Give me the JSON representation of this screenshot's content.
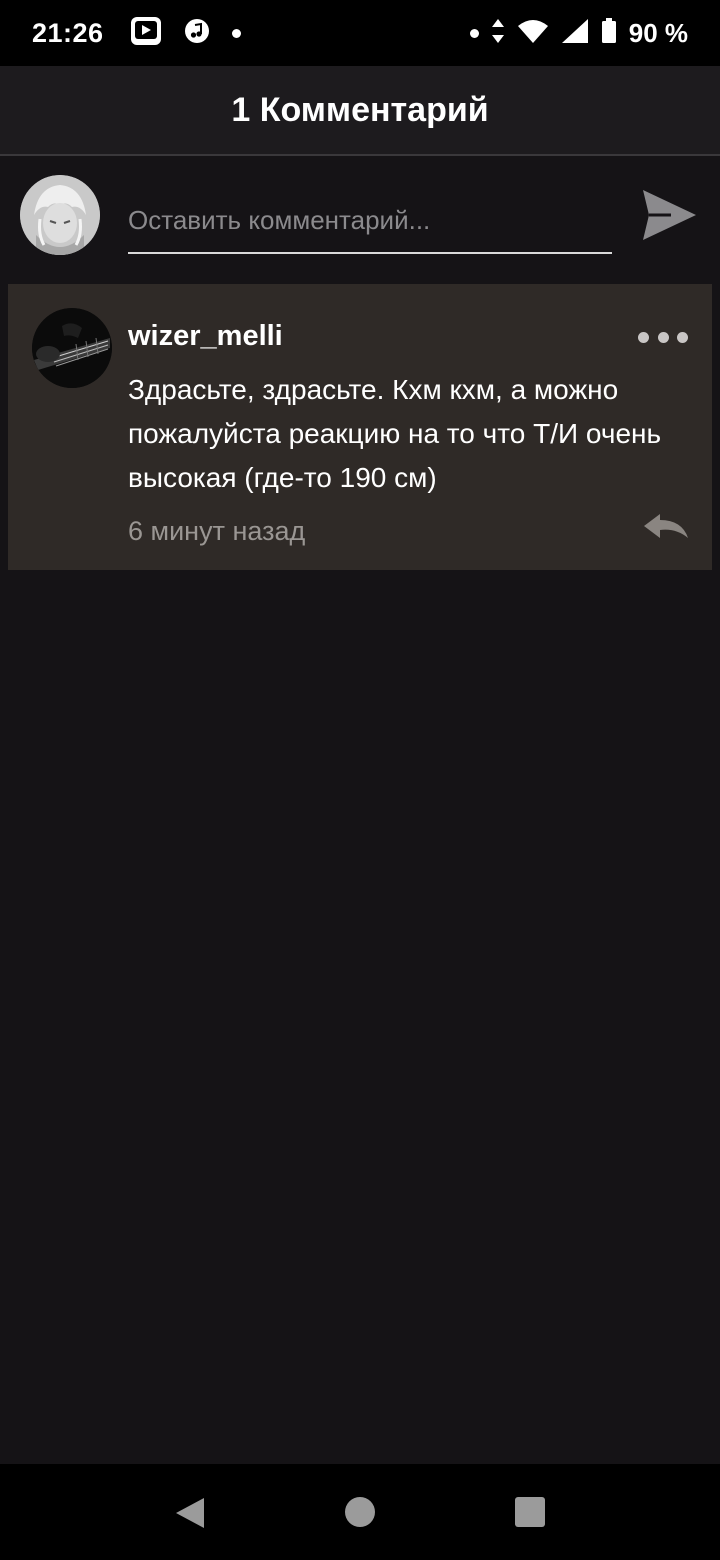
{
  "status_bar": {
    "time": "21:26",
    "battery": "90 %",
    "icons": [
      "video-app-icon",
      "music-icon",
      "notification-dot",
      "data-arrows-icon",
      "wifi-icon",
      "signal-icon",
      "battery-icon"
    ]
  },
  "header": {
    "title": "1 Комментарий"
  },
  "comment_input": {
    "placeholder": "Оставить комментарий..."
  },
  "comments": [
    {
      "author": "wizer_melli",
      "text": "Здрасьте, здрасьте. Кхм кхм, а можно пожалуйста реакцию на то что Т/И очень высокая (где-то 190 см)",
      "time": "6 минут назад"
    }
  ],
  "colors": {
    "background": "#151316",
    "header": "#1d1b1e",
    "card": "#2f2a27",
    "muted_text": "#9a9693"
  }
}
